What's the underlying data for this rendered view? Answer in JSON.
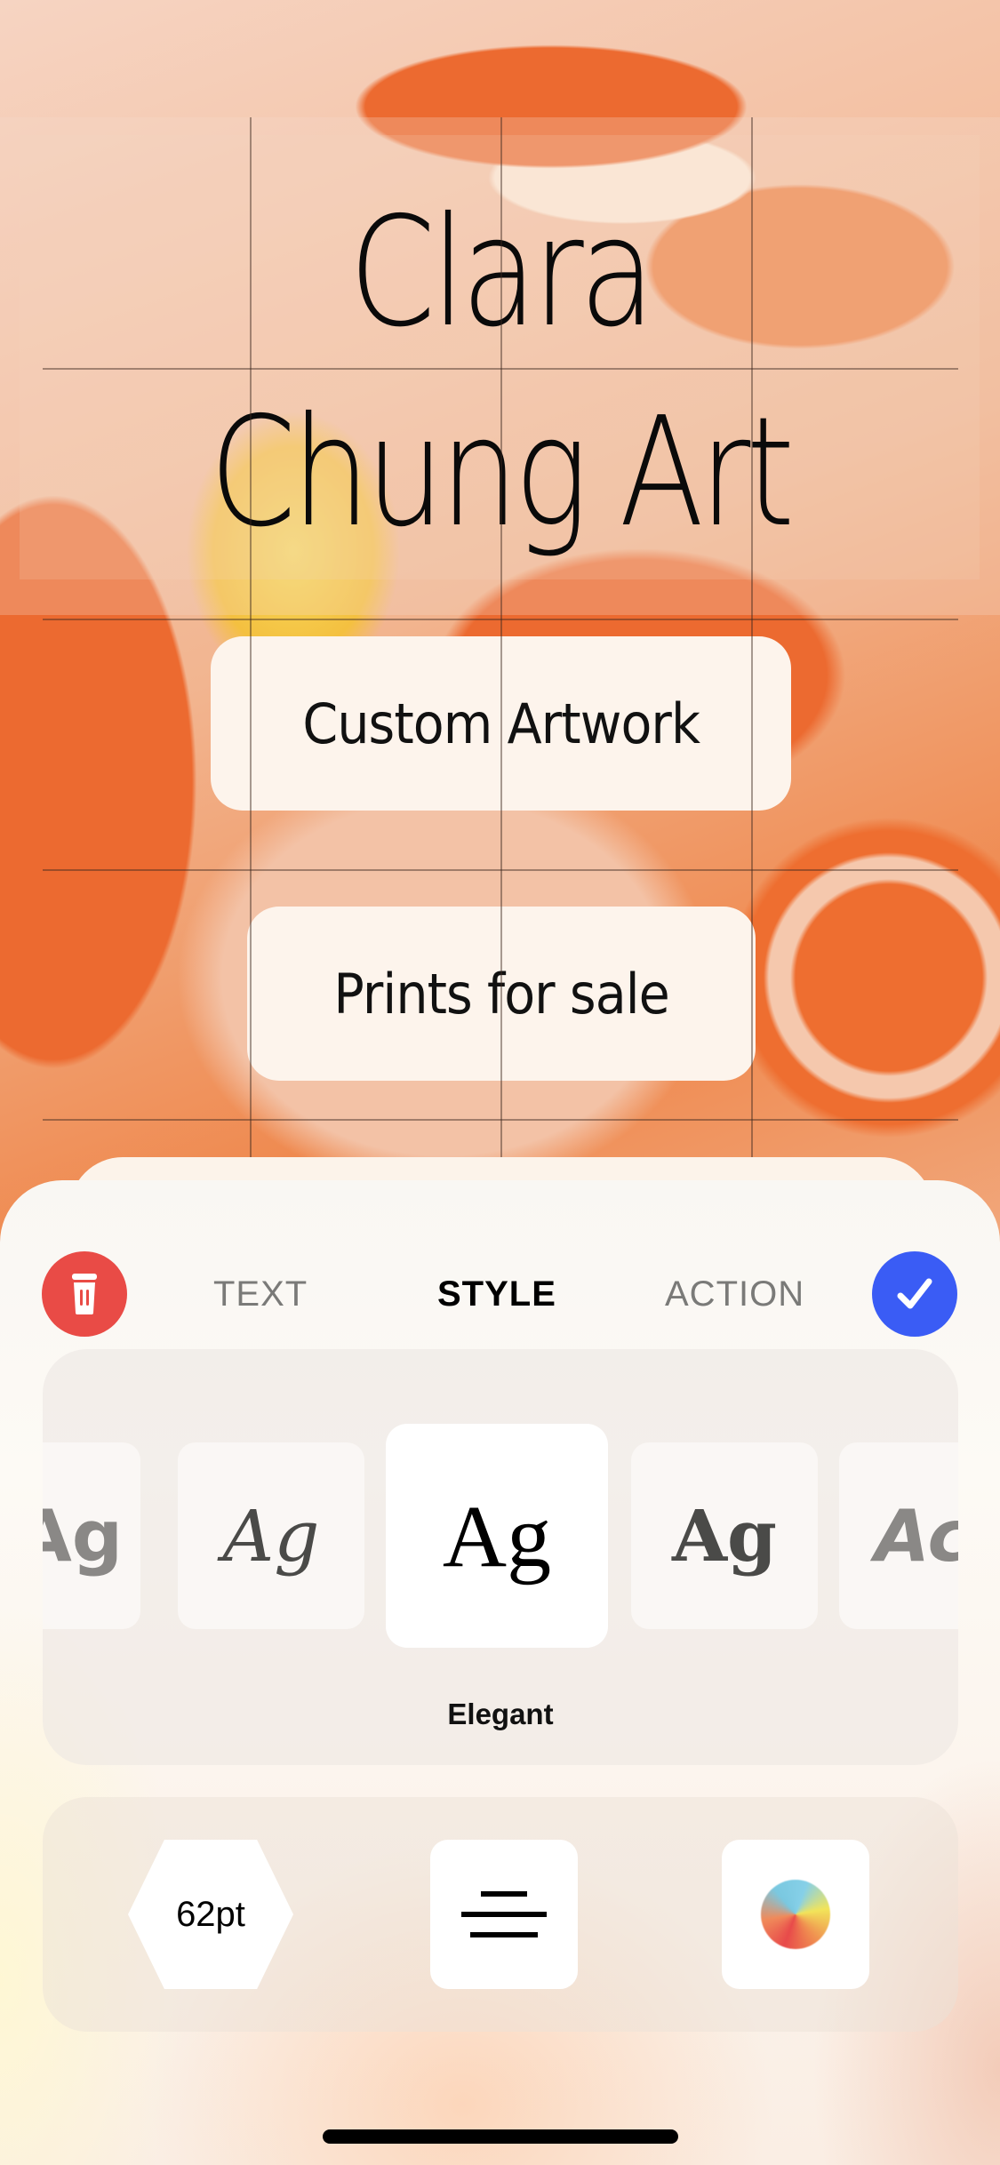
{
  "canvas": {
    "title_lines": [
      "Clara",
      "Chung Art"
    ],
    "link_buttons": [
      {
        "label": "Custom Artwork"
      },
      {
        "label": "Prints for sale"
      }
    ]
  },
  "editor": {
    "delete_icon": "trash-icon",
    "confirm_icon": "checkmark-icon",
    "tabs": [
      {
        "label": "TEXT",
        "active": false
      },
      {
        "label": "STYLE",
        "active": true
      },
      {
        "label": "ACTION",
        "active": false
      }
    ],
    "font_picker": {
      "sample": "Ag",
      "tiles": [
        {
          "sample": "Ag"
        },
        {
          "sample": "Ag"
        },
        {
          "sample": "Ag",
          "selected": true
        },
        {
          "sample": "Ag"
        },
        {
          "sample": "Ac"
        }
      ],
      "selected_name": "Elegant"
    },
    "tools": {
      "size_label": "62pt",
      "align_icon": "align-center-icon",
      "color_icon": "color-wheel-icon"
    }
  },
  "colors": {
    "delete": "#e94b46",
    "confirm": "#3a5cf5",
    "accent_orange": "#ec6a30"
  }
}
